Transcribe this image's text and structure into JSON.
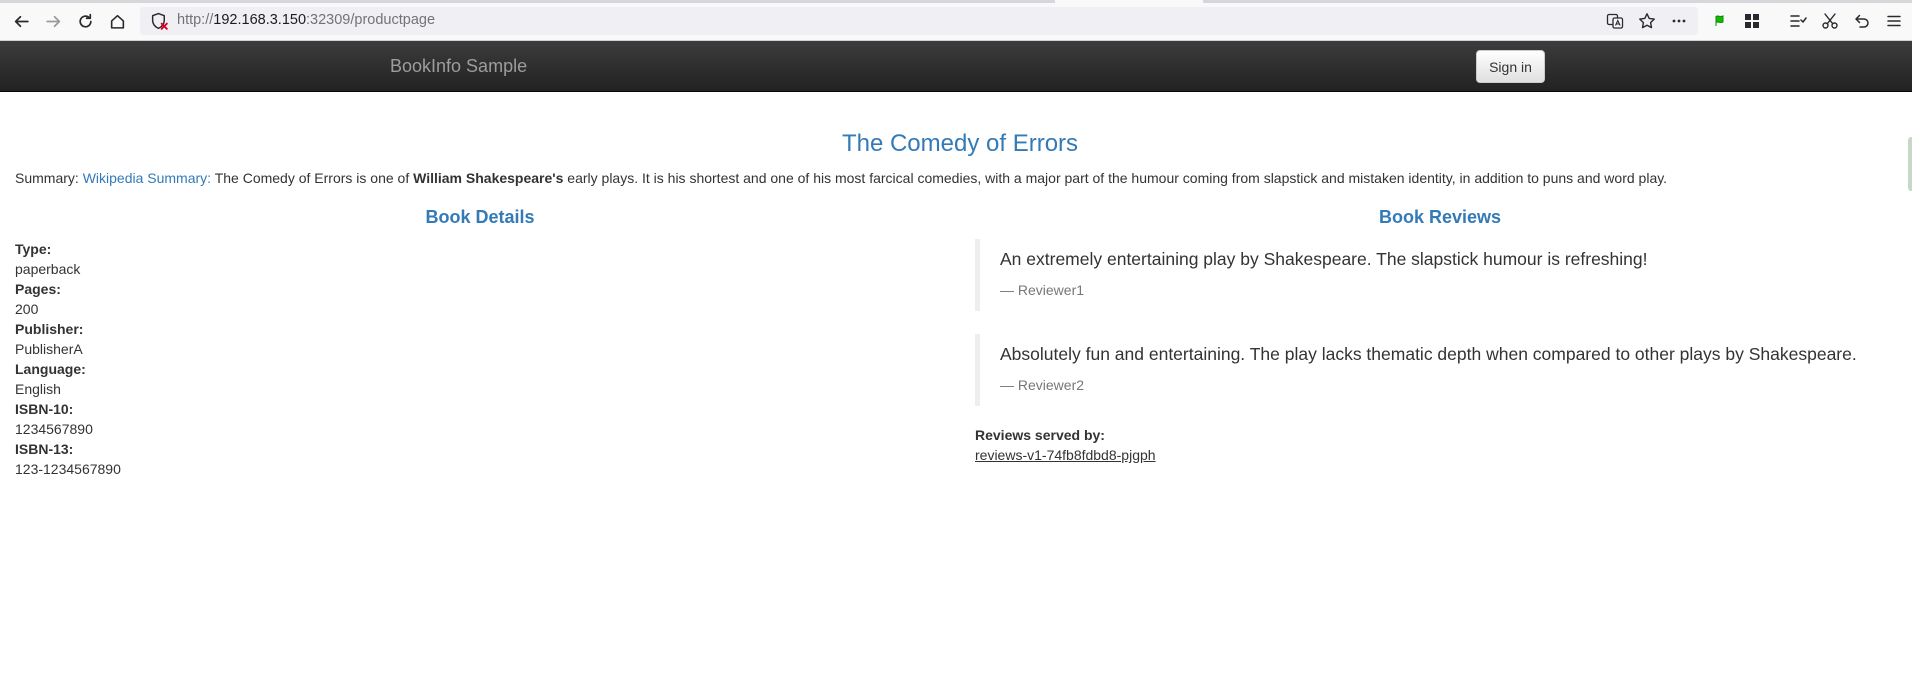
{
  "browser": {
    "url_prefix": "http://",
    "url_host": "192.168.3.150",
    "url_rest": ":32309/productpage",
    "icons": [
      "back-arrow-icon",
      "forward-arrow-icon",
      "reload-icon",
      "home-icon",
      "shield-blocked-icon",
      "translate-icon",
      "star-icon",
      "more-icon",
      "flag-icon",
      "grid-icon",
      "reading-list-icon",
      "scissors-icon",
      "undo-icon",
      "menu-icon"
    ]
  },
  "navbar": {
    "brand": "BookInfo Sample",
    "signin_label": "Sign in"
  },
  "book": {
    "title": "The Comedy of Errors",
    "summary_label": "Summary: ",
    "summary_link": "Wikipedia Summary:",
    "summary_text_1": " The Comedy of Errors is one of ",
    "summary_bold": "William Shakespeare's",
    "summary_text_2": " early plays. It is his shortest and one of his most farcical comedies, with a major part of the humour coming from slapstick and mistaken identity, in addition to puns and word play."
  },
  "details": {
    "heading": "Book Details",
    "fields": [
      {
        "label": "Type:",
        "value": "paperback"
      },
      {
        "label": "Pages:",
        "value": "200"
      },
      {
        "label": "Publisher:",
        "value": "PublisherA"
      },
      {
        "label": "Language:",
        "value": "English"
      },
      {
        "label": "ISBN-10:",
        "value": "1234567890"
      },
      {
        "label": "ISBN-13:",
        "value": "123-1234567890"
      }
    ]
  },
  "reviews": {
    "heading": "Book Reviews",
    "items": [
      {
        "text": "An extremely entertaining play by Shakespeare. The slapstick humour is refreshing!",
        "author": "— Reviewer1"
      },
      {
        "text": "Absolutely fun and entertaining. The play lacks thematic depth when compared to other plays by Shakespeare.",
        "author": "— Reviewer2"
      }
    ],
    "served_label": "Reviews served by:",
    "served_by": "reviews-v1-74fb8fdbd8-pjgph"
  }
}
